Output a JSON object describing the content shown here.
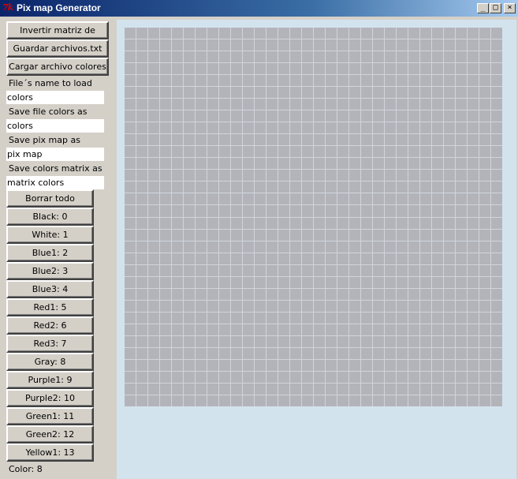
{
  "window": {
    "title": "Pix map Generator",
    "icon_text": "7k"
  },
  "buttons": {
    "invert": "Invertir matriz de colores",
    "save_txt": "Guardar archivos.txt",
    "load_colors": "Cargar archivo colores",
    "clear_all": "Borrar todo"
  },
  "fields": {
    "load_name": {
      "label": "File´s name to load",
      "value": "colors"
    },
    "save_colors": {
      "label": "Save file colors as",
      "value": "colors"
    },
    "save_pixmap": {
      "label": "Save pix map as",
      "value": "pix map"
    },
    "save_matrix": {
      "label": "Save colors matrix as",
      "value": "matrix colors"
    }
  },
  "colors": [
    {
      "label": "Black: 0"
    },
    {
      "label": "White: 1"
    },
    {
      "label": "Blue1: 2"
    },
    {
      "label": "Blue2: 3"
    },
    {
      "label": "Blue3: 4"
    },
    {
      "label": "Red1: 5"
    },
    {
      "label": "Red2: 6"
    },
    {
      "label": "Red3: 7"
    },
    {
      "label": "Gray: 8"
    },
    {
      "label": "Purple1: 9"
    },
    {
      "label": "Purple2: 10"
    },
    {
      "label": "Green1: 11"
    },
    {
      "label": "Green2: 12"
    },
    {
      "label": "Yellow1: 13"
    }
  ],
  "status": {
    "color_text": "Color: 8"
  },
  "grid": {
    "rows": 32,
    "cols": 32,
    "cell_color": "#b3b4ba",
    "line_color": "#d0d5db",
    "background_color": "#d3e3ee"
  }
}
